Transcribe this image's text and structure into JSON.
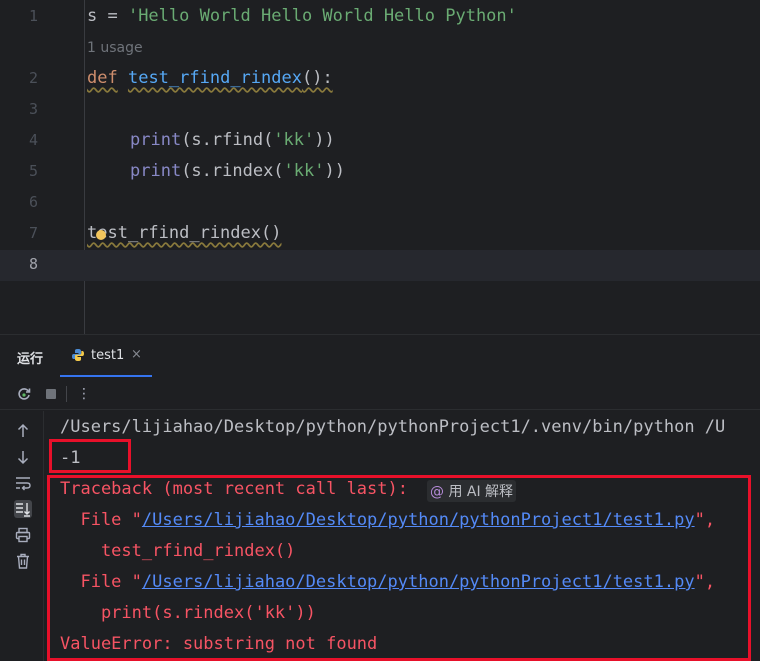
{
  "editor": {
    "usage_hint": "1 usage",
    "lines": [
      {
        "num": "1"
      },
      {
        "num": "2"
      },
      {
        "num": "3"
      },
      {
        "num": "4"
      },
      {
        "num": "5"
      },
      {
        "num": "6"
      },
      {
        "num": "7"
      },
      {
        "num": "8"
      }
    ],
    "code": {
      "l1_var": "s = ",
      "l1_str": "'Hello World Hello World Hello Python'",
      "l2_kw": "def",
      "l2_fn": "test_rfind_rindex",
      "l2_rest": "():",
      "l4_builtin": "print",
      "l4_rest1": "(s.rfind(",
      "l4_str": "'kk'",
      "l4_rest2": "))",
      "l5_builtin": "print",
      "l5_rest1": "(s.rindex(",
      "l5_str": "'kk'",
      "l5_rest2": "))",
      "l7_call": "test_rfind_rindex()"
    }
  },
  "run_panel": {
    "title": "运行",
    "tab_label": "test1",
    "tab_close": "×",
    "toolbar": {
      "rerun_icon": "rerun-icon",
      "stop_icon": "stop-icon",
      "more_label": "⋮"
    },
    "side_tools": [
      "up-arrow-icon",
      "down-arrow-icon",
      "soft-wrap-icon",
      "scroll-to-end-icon",
      "print-icon",
      "trash-icon"
    ]
  },
  "console": {
    "command": "/Users/lijiahao/Desktop/python/pythonProject1/.venv/bin/python /U",
    "output": "-1",
    "traceback_header": "Traceback (most recent call last):",
    "ai_chip_label": "用 AI 解释",
    "frame1_prefix": "  File \"",
    "frame1_path": "/Users/lijiahao/Desktop/python/pythonProject1/test1.py",
    "frame1_suffix": "\",",
    "frame1_code": "    test_rfind_rindex()",
    "frame2_prefix": "  File \"",
    "frame2_path": "/Users/lijiahao/Desktop/python/pythonProject1/test1.py",
    "frame2_suffix": "\",",
    "frame2_code": "    print(s.rindex('kk'))",
    "error_line": "ValueError: substring not found"
  },
  "colors": {
    "highlight_box": "#e8102a",
    "error_text": "#f75464",
    "link": "#548af7"
  }
}
